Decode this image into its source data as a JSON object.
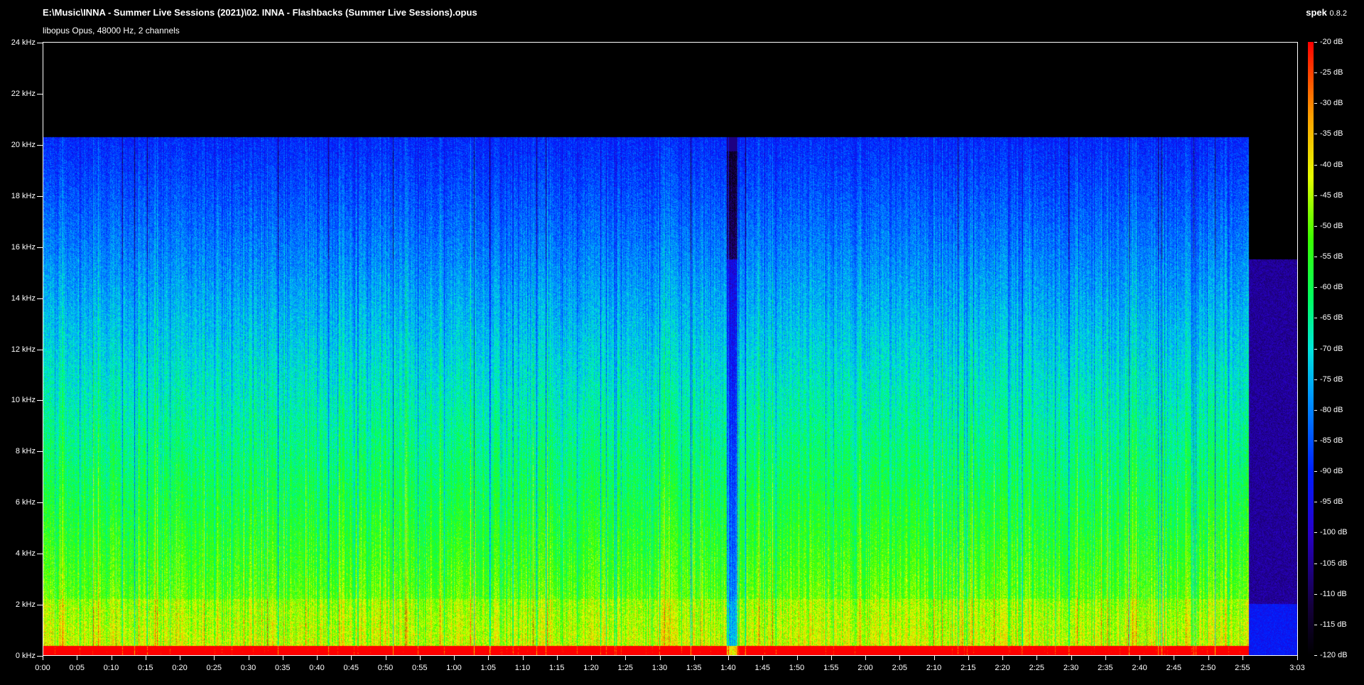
{
  "header": {
    "file_path": "E:\\Music\\INNA - Summer Live Sessions (2021)\\02. INNA - Flashbacks (Summer Live Sessions).opus",
    "stream_info": "libopus Opus, 48000 Hz, 2 channels",
    "app_name": "spek",
    "app_version": "0.8.2"
  },
  "colors": {
    "background": "#000000",
    "axis": "#ffffff",
    "palette_low": "#000000",
    "palette_mid": "#00ff66",
    "palette_high": "#ff0000"
  },
  "chart_data": {
    "type": "heatmap",
    "frequency_axis": {
      "unit": "kHz",
      "range": [
        0,
        24
      ],
      "tick_labels": [
        "24 kHz",
        "22 kHz",
        "20 kHz",
        "18 kHz",
        "16 kHz",
        "14 kHz",
        "12 kHz",
        "10 kHz",
        "8 kHz",
        "6 kHz",
        "4 kHz",
        "2 kHz",
        "0 kHz"
      ]
    },
    "time_axis": {
      "unit": "m:ss",
      "range_seconds": [
        0,
        183
      ],
      "tick_labels": [
        "0:00",
        "0:05",
        "0:10",
        "0:15",
        "0:20",
        "0:25",
        "0:30",
        "0:35",
        "0:40",
        "0:45",
        "0:50",
        "0:55",
        "1:00",
        "1:05",
        "1:10",
        "1:15",
        "1:20",
        "1:25",
        "1:30",
        "1:35",
        "1:40",
        "1:45",
        "1:50",
        "1:55",
        "2:00",
        "2:05",
        "2:10",
        "2:15",
        "2:20",
        "2:25",
        "2:30",
        "2:35",
        "2:40",
        "2:45",
        "2:50",
        "2:55",
        "3:03"
      ]
    },
    "color_scale": {
      "unit": "dB",
      "range": [
        -120,
        -20
      ],
      "tick_labels": [
        "-20 dB",
        "-25 dB",
        "-30 dB",
        "-35 dB",
        "-40 dB",
        "-45 dB",
        "-50 dB",
        "-55 dB",
        "-60 dB",
        "-65 dB",
        "-70 dB",
        "-75 dB",
        "-80 dB",
        "-85 dB",
        "-90 dB",
        "-95 dB",
        "-100 dB",
        "-105 dB",
        "-110 dB",
        "-115 dB",
        "-120 dB"
      ]
    },
    "observed": {
      "lowpass_cutoff_khz": 20,
      "secondary_band_khz": 15.5,
      "content_end_seconds": 176,
      "quiet_dip_seconds": 100.5
    }
  }
}
